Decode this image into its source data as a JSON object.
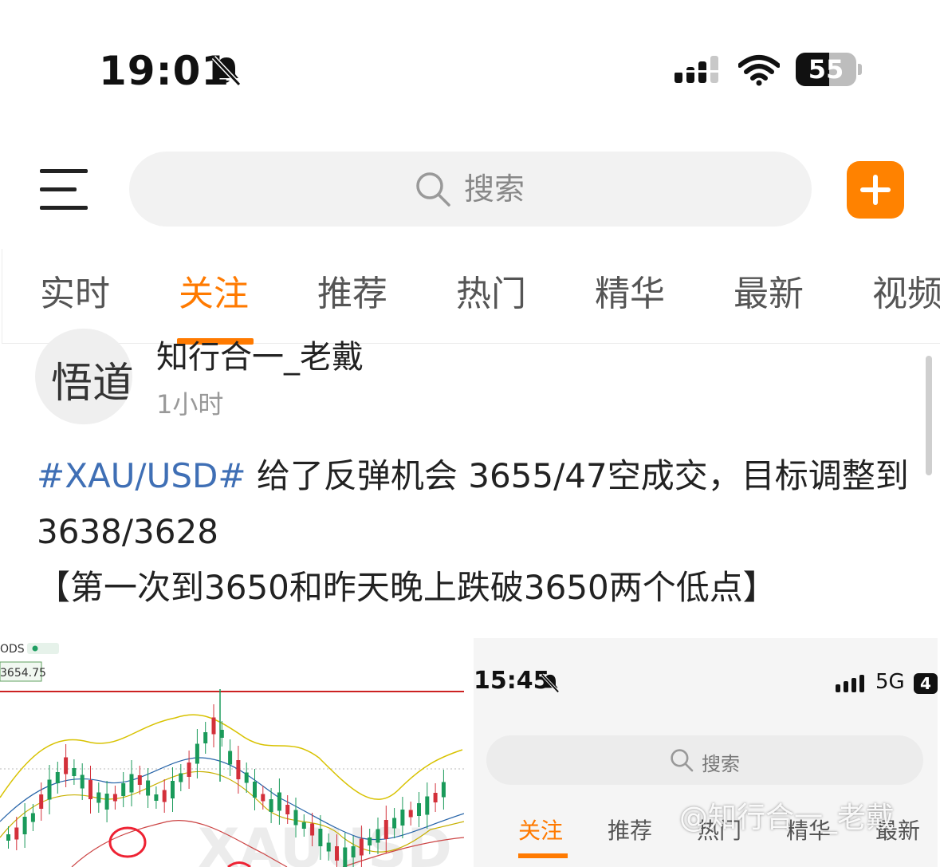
{
  "status_bar": {
    "time": "19:01",
    "battery": "55",
    "battery_level": 0.55
  },
  "header": {
    "search_placeholder": "搜索"
  },
  "tabs": [
    {
      "label": "实时",
      "active": false
    },
    {
      "label": "关注",
      "active": true
    },
    {
      "label": "推荐",
      "active": false
    },
    {
      "label": "热门",
      "active": false
    },
    {
      "label": "精华",
      "active": false
    },
    {
      "label": "最新",
      "active": false
    },
    {
      "label": "视频",
      "active": false
    }
  ],
  "post": {
    "avatar_text": "悟道",
    "author": "知行合一_老戴",
    "time": "1小时",
    "hashtag": "#XAU/USD#",
    "line1": " 给了反弹机会 3655/47空成交，目标调整到3638/3628",
    "line2": "【第一次到3650和昨天晚上跌破3650两个低点】"
  },
  "images": {
    "chart": {
      "label_top": "ODS",
      "price_label": "3654.75",
      "watermark_text": "XAUUSD"
    },
    "screenshot": {
      "time": "15:45",
      "network": "5G",
      "battery": "4",
      "search_placeholder": "搜索",
      "tabs": [
        "关注",
        "推荐",
        "热门",
        "精华",
        "最新"
      ]
    }
  },
  "watermark": "@知行合一_老戴",
  "colors": {
    "accent": "#ff7a00",
    "hashtag": "#3f6fb5",
    "add_button": "#ff8200"
  }
}
